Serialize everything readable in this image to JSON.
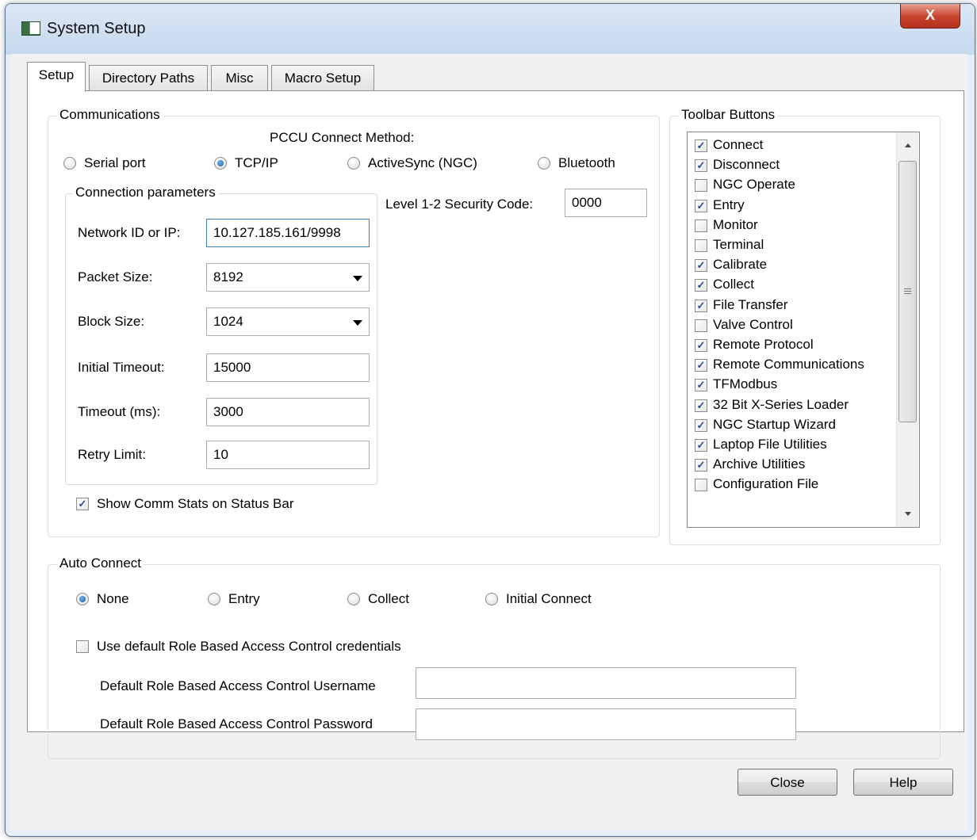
{
  "window": {
    "title": "System Setup",
    "close_glyph": "X"
  },
  "tabs": [
    "Setup",
    "Directory Paths",
    "Misc",
    "Macro Setup"
  ],
  "communications": {
    "legend": "Communications",
    "connect_method_label": "PCCU Connect Method:",
    "methods": [
      "Serial port",
      "TCP/IP",
      "ActiveSync (NGC)",
      "Bluetooth"
    ],
    "selected_method": "TCP/IP",
    "security_code_label": "Level 1-2 Security Code:",
    "security_code": "0000",
    "params": {
      "legend": "Connection parameters",
      "network_label": "Network ID or IP:",
      "network_value": "10.127.185.161/9998",
      "packet_label": "Packet Size:",
      "packet_value": "8192",
      "block_label": "Block Size:",
      "block_value": "1024",
      "initial_timeout_label": "Initial Timeout:",
      "initial_timeout_value": "15000",
      "timeout_label": "Timeout (ms):",
      "timeout_value": "3000",
      "retry_label": "Retry Limit:",
      "retry_value": "10"
    },
    "show_stats_label": "Show Comm Stats on Status Bar",
    "show_stats_checked": true
  },
  "toolbar_buttons": {
    "legend": "Toolbar Buttons",
    "items": [
      {
        "label": "Connect",
        "checked": true
      },
      {
        "label": "Disconnect",
        "checked": true
      },
      {
        "label": "NGC Operate",
        "checked": false
      },
      {
        "label": "Entry",
        "checked": true
      },
      {
        "label": "Monitor",
        "checked": false
      },
      {
        "label": "Terminal",
        "checked": false
      },
      {
        "label": "Calibrate",
        "checked": true
      },
      {
        "label": "Collect",
        "checked": true
      },
      {
        "label": "File Transfer",
        "checked": true
      },
      {
        "label": "Valve Control",
        "checked": false
      },
      {
        "label": "Remote Protocol",
        "checked": true
      },
      {
        "label": "Remote Communications",
        "checked": true
      },
      {
        "label": "TFModbus",
        "checked": true
      },
      {
        "label": "32 Bit X-Series Loader",
        "checked": true
      },
      {
        "label": "NGC Startup Wizard",
        "checked": true
      },
      {
        "label": "Laptop File Utilities",
        "checked": true
      },
      {
        "label": "Archive Utilities",
        "checked": true
      },
      {
        "label": "Configuration File",
        "checked": false
      }
    ]
  },
  "auto_connect": {
    "legend": "Auto Connect",
    "options": [
      "None",
      "Entry",
      "Collect",
      "Initial Connect"
    ],
    "selected": "None",
    "rbac_label": "Use default Role Based Access Control credentials",
    "rbac_checked": false,
    "username_label": "Default Role Based Access Control Username",
    "username_value": "",
    "password_label": "Default Role Based Access Control Password",
    "password_value": ""
  },
  "buttons": {
    "close": "Close",
    "help": "Help"
  },
  "colors": {
    "accent": "#1c5da8",
    "check": "#2c4a9e",
    "close_button": "#c7402a"
  }
}
